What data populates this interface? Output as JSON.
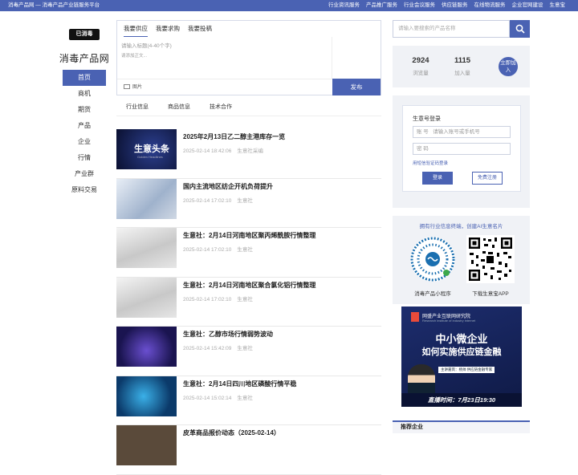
{
  "topbar": {
    "left_text": "消毒产品网 — 消毒产品产业链服务平台",
    "links": [
      "行业资讯服务",
      "产品推广服务",
      "行业会议服务",
      "供应链服务",
      "在线物流服务",
      "企业官网建设",
      "生意宝"
    ]
  },
  "sidebar": {
    "logo_text": "已消毒",
    "site_name": "消毒产品网",
    "nav": [
      "首页",
      "商机",
      "期货",
      "产品",
      "企业",
      "行情",
      "产业群",
      "原料交易"
    ]
  },
  "post_box": {
    "tabs": [
      "我要供应",
      "我要求购",
      "我要投稿"
    ],
    "title_placeholder": "请输入标题(4-40个字)",
    "body_placeholder": "请添加正文...",
    "image_label": "图片",
    "publish_label": "发布"
  },
  "subtabs": [
    "行业信息",
    "商品信息",
    "技术合作"
  ],
  "news": [
    {
      "title": "2025年2月13日乙二醇主港库存一览",
      "date": "2025-02-14 18:42:06",
      "source": "生意社采编",
      "thumb_text": "生意头条",
      "thumb_sub": "Golden Headlines"
    },
    {
      "title": "国内主流地区纺企开机负荷提升",
      "date": "2025-02-14 17:02:10",
      "source": "生意社"
    },
    {
      "title": "生意社：2月14日河南地区聚丙烯酰胺行情整理",
      "date": "2025-02-14 17:02:10",
      "source": "生意社"
    },
    {
      "title": "生意社：2月14日河南地区聚合氯化铝行情整理",
      "date": "2025-02-14 17:02:10",
      "source": "生意社"
    },
    {
      "title": "生意社：乙醇市场行情弱势波动",
      "date": "2025-02-14 15:42:09",
      "source": "生意社"
    },
    {
      "title": "生意社：2月14日四川地区磷酸行情平稳",
      "date": "2025-02-14 15:02:14",
      "source": "生意社"
    },
    {
      "title": "皮革商品报价动态（2025-02-14）",
      "date": "",
      "source": ""
    }
  ],
  "search": {
    "placeholder": "请输入要搜索的产品名称",
    "icon": "search-icon"
  },
  "stats": {
    "views": "2924",
    "views_label": "浏览量",
    "joins": "1115",
    "joins_label": "加入量",
    "join_button": "立即加入"
  },
  "login": {
    "title": "生意号登录",
    "account_label": "账 号",
    "account_placeholder": "请输入账号或手机号",
    "password_placeholder": "密 码",
    "forgot": "用短信验证码登录",
    "login_button": "登录",
    "register_button": "免费注册"
  },
  "qr": {
    "title": "拥有行业信息终端，创建AI生意名片",
    "left_caption": "消毒产品小程序",
    "right_caption": "下载生意宝APP"
  },
  "banner": {
    "org": "网盛产业互联网研究院",
    "org_en": "Research institute of industry internet",
    "line1": "中小微企业",
    "line2": "如何实施供应链金融",
    "speaker": "主讲嘉宾：杨帅  供应链金融专家",
    "footer": "直播时间：7月23日19:30"
  },
  "recommend": {
    "title": "推荐企业"
  },
  "colors": {
    "brand": "#4a62b3"
  }
}
